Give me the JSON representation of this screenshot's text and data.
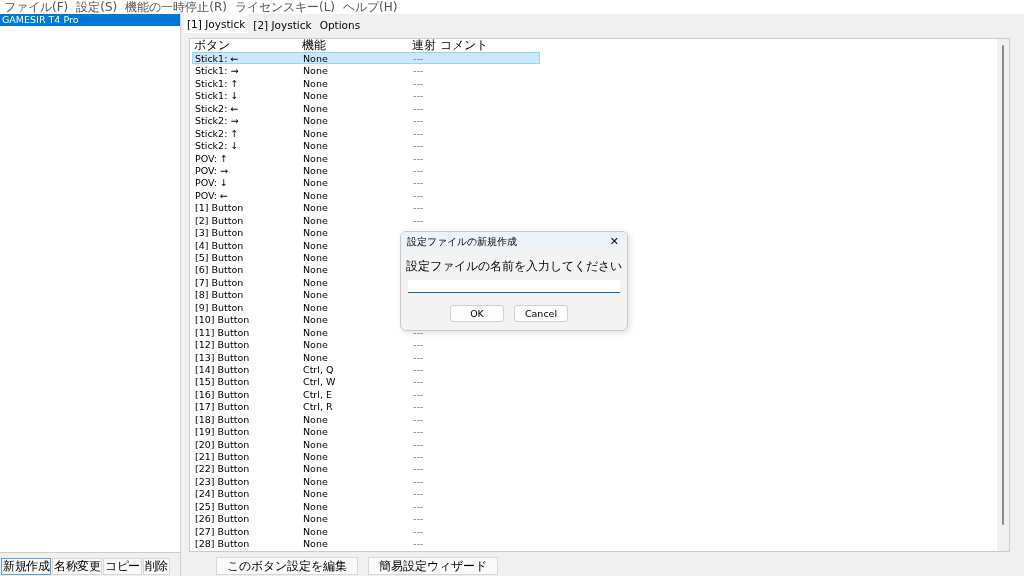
{
  "menu": [
    "ファイル(F)",
    "設定(S)",
    "機能の一時停止(R)",
    "ライセンスキー(L)",
    "ヘルプ(H)"
  ],
  "profiles": {
    "items": [
      {
        "label": "GAMESIR T4 Pro",
        "selected": true
      }
    ],
    "buttons": [
      "新規作成",
      "名称変更",
      "コピー",
      "削除"
    ]
  },
  "tabs": [
    {
      "label": "[1] Joystick",
      "selected": true
    },
    {
      "label": "[2] Joystick",
      "selected": false
    },
    {
      "label": "Options",
      "selected": false
    }
  ],
  "table": {
    "columns": [
      "ボタン",
      "機能",
      "連射",
      "コメント"
    ],
    "rows": [
      {
        "button": "Stick1: ←",
        "function": "None",
        "rapid": "---",
        "selected": true
      },
      {
        "button": "Stick1: →",
        "function": "None",
        "rapid": "---",
        "selected": false
      },
      {
        "button": "Stick1: ↑",
        "function": "None",
        "rapid": "---",
        "selected": false
      },
      {
        "button": "Stick1: ↓",
        "function": "None",
        "rapid": "---",
        "selected": false
      },
      {
        "button": "Stick2: ←",
        "function": "None",
        "rapid": "---",
        "selected": false
      },
      {
        "button": "Stick2: →",
        "function": "None",
        "rapid": "---",
        "selected": false
      },
      {
        "button": "Stick2: ↑",
        "function": "None",
        "rapid": "---",
        "selected": false
      },
      {
        "button": "Stick2: ↓",
        "function": "None",
        "rapid": "---",
        "selected": false
      },
      {
        "button": "POV: ↑",
        "function": "None",
        "rapid": "---",
        "selected": false
      },
      {
        "button": "POV: →",
        "function": "None",
        "rapid": "---",
        "selected": false
      },
      {
        "button": "POV: ↓",
        "function": "None",
        "rapid": "---",
        "selected": false
      },
      {
        "button": "POV: ←",
        "function": "None",
        "rapid": "---",
        "selected": false
      },
      {
        "button": "[1] Button",
        "function": "None",
        "rapid": "---",
        "selected": false
      },
      {
        "button": "[2] Button",
        "function": "None",
        "rapid": "---",
        "selected": false
      },
      {
        "button": "[3] Button",
        "function": "None",
        "selected": false
      },
      {
        "button": "[4] Button",
        "function": "None",
        "selected": false
      },
      {
        "button": "[5] Button",
        "function": "None",
        "selected": false
      },
      {
        "button": "[6] Button",
        "function": "None",
        "selected": false
      },
      {
        "button": "[7] Button",
        "function": "None",
        "selected": false
      },
      {
        "button": "[8] Button",
        "function": "None",
        "selected": false
      },
      {
        "button": "[9] Button",
        "function": "None",
        "selected": false
      },
      {
        "button": "[10] Button",
        "function": "None",
        "selected": false
      },
      {
        "button": "[11] Button",
        "function": "None",
        "rapid": "---",
        "selected": false
      },
      {
        "button": "[12] Button",
        "function": "None",
        "rapid": "---",
        "selected": false
      },
      {
        "button": "[13] Button",
        "function": "None",
        "rapid": "---",
        "selected": false
      },
      {
        "button": "[14] Button",
        "function": "Ctrl, Q",
        "rapid": "---",
        "selected": false
      },
      {
        "button": "[15] Button",
        "function": "Ctrl, W",
        "rapid": "---",
        "selected": false
      },
      {
        "button": "[16] Button",
        "function": "Ctrl, E",
        "rapid": "---",
        "selected": false
      },
      {
        "button": "[17] Button",
        "function": "Ctrl, R",
        "rapid": "---",
        "selected": false
      },
      {
        "button": "[18] Button",
        "function": "None",
        "rapid": "---",
        "selected": false
      },
      {
        "button": "[19] Button",
        "function": "None",
        "rapid": "---",
        "selected": false
      },
      {
        "button": "[20] Button",
        "function": "None",
        "rapid": "---",
        "selected": false
      },
      {
        "button": "[21] Button",
        "function": "None",
        "rapid": "---",
        "selected": false
      },
      {
        "button": "[22] Button",
        "function": "None",
        "rapid": "---",
        "selected": false
      },
      {
        "button": "[23] Button",
        "function": "None",
        "rapid": "---",
        "selected": false
      },
      {
        "button": "[24] Button",
        "function": "None",
        "rapid": "---",
        "selected": false
      },
      {
        "button": "[25] Button",
        "function": "None",
        "rapid": "---",
        "selected": false
      },
      {
        "button": "[26] Button",
        "function": "None",
        "rapid": "---",
        "selected": false
      },
      {
        "button": "[27] Button",
        "function": "None",
        "rapid": "---",
        "selected": false
      },
      {
        "button": "[28] Button",
        "function": "None",
        "rapid": "---",
        "selected": false
      }
    ]
  },
  "actions": [
    "このボタン設定を編集",
    "簡易設定ウィザード"
  ],
  "dialog": {
    "title": "設定ファイルの新規作成",
    "close": "✕",
    "prompt": "設定ファイルの名前を入力してください",
    "buttons": [
      "OK",
      "Cancel"
    ]
  }
}
